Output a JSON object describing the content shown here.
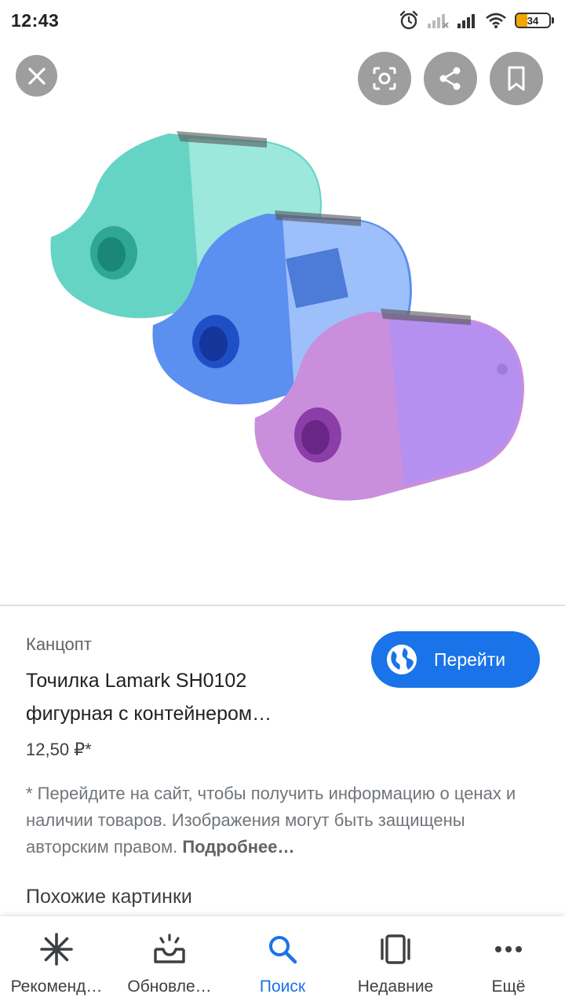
{
  "status_bar": {
    "time": "12:43",
    "battery_level": "34",
    "battery_fraction": 0.34,
    "icons": [
      "alarm-icon",
      "signal-no-sim-icon",
      "signal-icon",
      "wifi-icon",
      "battery-icon"
    ]
  },
  "viewer": {
    "buttons": [
      "close-icon",
      "lens-icon",
      "share-icon",
      "bookmark-icon"
    ],
    "image_colors": {
      "teal": "#66d4c4",
      "blue": "#5b8ff0",
      "violet": "#c98fdc"
    }
  },
  "product": {
    "source": "Канцопт",
    "title_line1": "Точилка Lamark SH0102",
    "title_line2": "фигурная с контейнером…",
    "price": "12,50 ₽*",
    "visit_label": "Перейти",
    "disclaimer": "* Перейдите на сайт, чтобы получить информацию о ценах и наличии товаров. Изображения могут быть защищены авторским правом.",
    "more_label": "Подробнее…",
    "similar_heading": "Похожие картинки"
  },
  "colors": {
    "accent": "#1a73e8",
    "button_gray": "#9e9e9e"
  },
  "nav": {
    "items": [
      {
        "label": "Рекоменд…",
        "icon": "asterisk-icon"
      },
      {
        "label": "Обновле…",
        "icon": "updates-icon"
      },
      {
        "label": "Поиск",
        "icon": "search-icon"
      },
      {
        "label": "Недавние",
        "icon": "recent-icon"
      },
      {
        "label": "Ещё",
        "icon": "more-dots-icon"
      }
    ],
    "active": "Поиск"
  }
}
